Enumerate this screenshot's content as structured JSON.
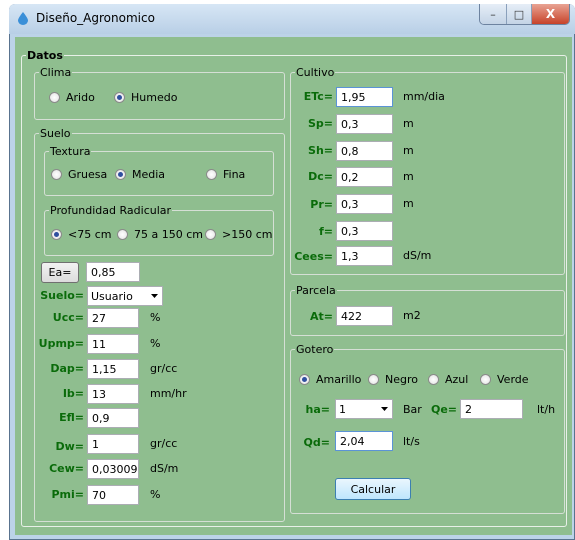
{
  "window": {
    "title": "Diseño_Agronomico",
    "minimize": "–",
    "maximize": "□",
    "close": "X"
  },
  "datos": {
    "legend": "Datos"
  },
  "clima": {
    "legend": "Clima",
    "options": [
      "Arido",
      "Humedo"
    ],
    "selected": "Humedo"
  },
  "suelo": {
    "legend": "Suelo",
    "textura": {
      "legend": "Textura",
      "options": [
        "Gruesa",
        "Media",
        "Fina"
      ],
      "selected": "Media"
    },
    "profundidad": {
      "legend": "Profundidad Radicular",
      "options": [
        "<75 cm",
        "75 a 150 cm",
        ">150 cm"
      ],
      "selected": "<75 cm"
    },
    "ea_button": "Ea=",
    "ea_value": "0,85",
    "fields": [
      {
        "label": "Suelo=",
        "value": "Usuario",
        "unit": "",
        "kind": "combo"
      },
      {
        "label": "Ucc=",
        "value": "27",
        "unit": "%"
      },
      {
        "label": "Upmp=",
        "value": "11",
        "unit": "%"
      },
      {
        "label": "Dap=",
        "value": "1,15",
        "unit": "gr/cc"
      },
      {
        "label": "Ib=",
        "value": "13",
        "unit": "mm/hr"
      },
      {
        "label": "Efl=",
        "value": "0,9",
        "unit": ""
      },
      {
        "label": "Dw=",
        "value": "1",
        "unit": "gr/cc"
      },
      {
        "label": "Cew=",
        "value": "0,03009",
        "unit": "dS/m"
      },
      {
        "label": "Pmi=",
        "value": "70",
        "unit": "%"
      }
    ]
  },
  "cultivo": {
    "legend": "Cultivo",
    "fields": [
      {
        "label": "ETc=",
        "value": "1,95",
        "unit": "mm/dia"
      },
      {
        "label": "Sp=",
        "value": "0,3",
        "unit": "m"
      },
      {
        "label": "Sh=",
        "value": "0,8",
        "unit": "m"
      },
      {
        "label": "Dc=",
        "value": "0,2",
        "unit": "m"
      },
      {
        "label": "Pr=",
        "value": "0,3",
        "unit": "m"
      },
      {
        "label": "f=",
        "value": "0,3",
        "unit": ""
      },
      {
        "label": "Cees=",
        "value": "1,3",
        "unit": "dS/m"
      }
    ]
  },
  "parcela": {
    "legend": "Parcela",
    "label": "At=",
    "value": "422",
    "unit": "m2"
  },
  "gotero": {
    "legend": "Gotero",
    "options": [
      "Amarillo",
      "Negro",
      "Azul",
      "Verde"
    ],
    "selected": "Amarillo",
    "ha_label": "ha=",
    "ha_value": "1",
    "ha_unit": "Bar",
    "qe_label": "Qe=",
    "qe_value": "2",
    "qe_unit": "lt/h",
    "qd_label": "Qd=",
    "qd_value": "2,04",
    "qd_unit": "lt/s",
    "calc_button": "Calcular"
  },
  "colors": {
    "client_bg": "#8fbe8f",
    "label_green": "#0a6b0a",
    "titlebar": "#c8dcf0",
    "close_red": "#c7432a"
  }
}
